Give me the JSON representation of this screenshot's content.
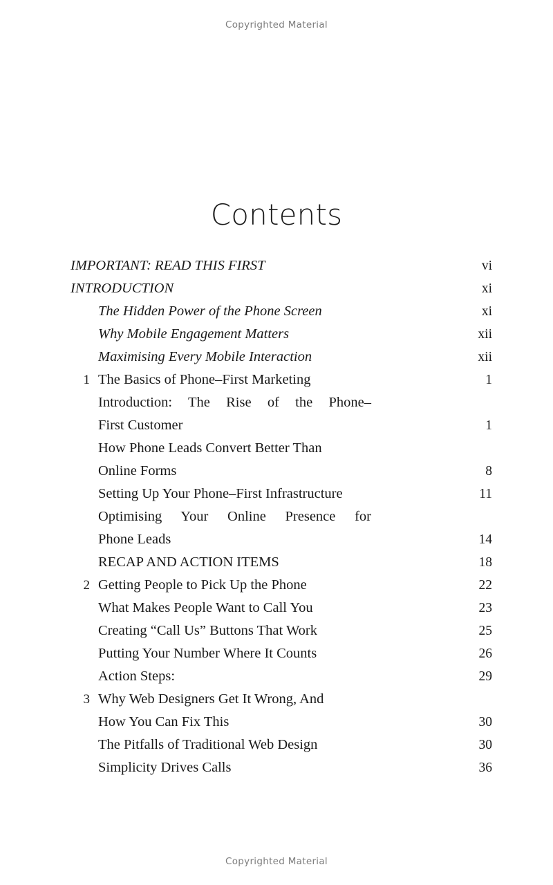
{
  "running_head": "Copyrighted Material",
  "running_foot": "Copyrighted Material",
  "title": "Contents",
  "toc": {
    "entries": [
      {
        "num": "",
        "text": "IMPORTANT: READ THIS FIRST",
        "page": "vi",
        "level": "front",
        "style": "italic"
      },
      {
        "num": "",
        "text": "INTRODUCTION",
        "page": "xi",
        "level": "front",
        "style": "italic"
      },
      {
        "num": "",
        "text": "The Hidden Power of the Phone Screen",
        "page": "xi",
        "level": "sub",
        "style": "italic"
      },
      {
        "num": "",
        "text": "Why Mobile Engagement Matters",
        "page": "xii",
        "level": "sub",
        "style": "italic"
      },
      {
        "num": "",
        "text": "Maximising Every Mobile Interaction",
        "page": "xii",
        "level": "sub",
        "style": "italic"
      },
      {
        "num": "1",
        "text": "The Basics of Phone–First Marketing",
        "page": "1",
        "level": "chap",
        "style": "roman"
      },
      {
        "num": "",
        "text": "Introduction:  The Rise of the Phone–",
        "page": "",
        "level": "chap",
        "style": "roman",
        "justify": true
      },
      {
        "num": "",
        "text": "First Customer",
        "page": "1",
        "level": "chap",
        "style": "roman"
      },
      {
        "num": "",
        "text": "How Phone Leads Convert Better Than",
        "page": "",
        "level": "chap",
        "style": "roman"
      },
      {
        "num": "",
        "text": "Online Forms",
        "page": "8",
        "level": "chap",
        "style": "roman"
      },
      {
        "num": "",
        "text": "Setting Up Your Phone–First Infrastructure",
        "page": "11",
        "level": "chap",
        "style": "roman"
      },
      {
        "num": "",
        "text": "Optimising Your Online Presence for",
        "page": "",
        "level": "chap",
        "style": "roman",
        "justify": true
      },
      {
        "num": "",
        "text": "Phone Leads",
        "page": "14",
        "level": "chap",
        "style": "roman"
      },
      {
        "num": "",
        "text": "RECAP AND ACTION ITEMS",
        "page": "18",
        "level": "chap",
        "style": "roman"
      },
      {
        "num": "2",
        "text": "Getting People to Pick Up the Phone",
        "page": "22",
        "level": "chap",
        "style": "roman"
      },
      {
        "num": "",
        "text": "What Makes People Want to Call You",
        "page": "23",
        "level": "chap",
        "style": "roman"
      },
      {
        "num": "",
        "text": "Creating “Call Us” Buttons That Work",
        "page": "25",
        "level": "chap",
        "style": "roman"
      },
      {
        "num": "",
        "text": "Putting Your Number Where It Counts",
        "page": "26",
        "level": "chap",
        "style": "roman"
      },
      {
        "num": "",
        "text": "Action Steps:",
        "page": "29",
        "level": "chap",
        "style": "roman"
      },
      {
        "num": "3",
        "text": "Why Web Designers Get It Wrong, And",
        "page": "",
        "level": "chap",
        "style": "roman"
      },
      {
        "num": "",
        "text": "How You Can Fix This",
        "page": "30",
        "level": "chap",
        "style": "roman"
      },
      {
        "num": "",
        "text": "The Pitfalls of Traditional Web Design",
        "page": "30",
        "level": "chap",
        "style": "roman"
      },
      {
        "num": "",
        "text": "Simplicity Drives Calls",
        "page": "36",
        "level": "chap",
        "style": "roman"
      }
    ]
  }
}
